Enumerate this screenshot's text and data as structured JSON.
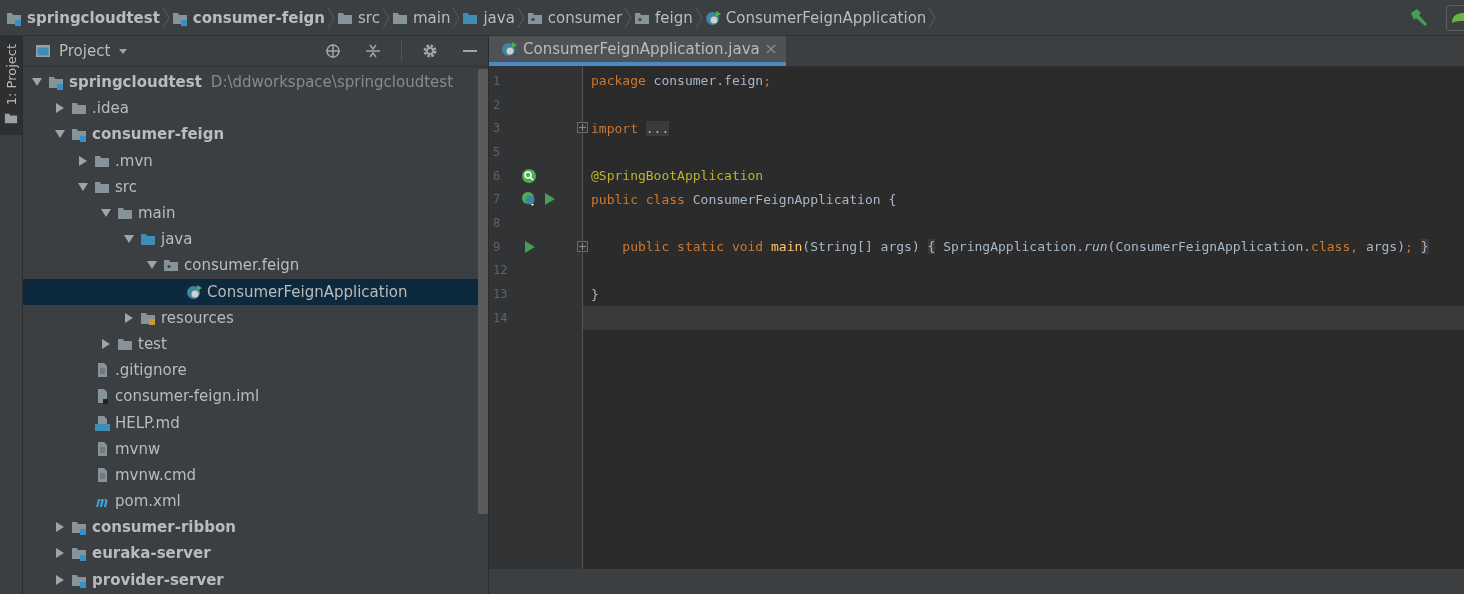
{
  "breadcrumbs": [
    {
      "label": "springcloudtest",
      "kind": "module",
      "bold": true
    },
    {
      "label": "consumer-feign",
      "kind": "module",
      "bold": true
    },
    {
      "label": "src",
      "kind": "folder",
      "bold": false
    },
    {
      "label": "main",
      "kind": "folder",
      "bold": false
    },
    {
      "label": "java",
      "kind": "source",
      "bold": false
    },
    {
      "label": "consumer",
      "kind": "package",
      "bold": false
    },
    {
      "label": "feign",
      "kind": "package",
      "bold": false
    },
    {
      "label": "ConsumerFeignApplication",
      "kind": "spring-class",
      "bold": false
    }
  ],
  "side_stripe": {
    "tab": "1: Project",
    "selected": true
  },
  "project_panel": {
    "title": "Project",
    "tree": [
      {
        "label": "springcloudtest",
        "path": "D:\\ddworkspace\\springcloudtest",
        "kind": "module",
        "bold": true,
        "expanded": true,
        "selected": false,
        "children": [
          {
            "label": ".idea",
            "kind": "folder",
            "bold": false,
            "expanded": false,
            "selected": false
          },
          {
            "label": "consumer-feign",
            "kind": "module",
            "bold": true,
            "expanded": true,
            "selected": false,
            "children": [
              {
                "label": ".mvn",
                "kind": "folder",
                "bold": false,
                "expanded": false,
                "selected": false
              },
              {
                "label": "src",
                "kind": "folder",
                "bold": false,
                "expanded": true,
                "selected": false,
                "children": [
                  {
                    "label": "main",
                    "kind": "folder",
                    "bold": false,
                    "expanded": true,
                    "selected": false,
                    "children": [
                      {
                        "label": "java",
                        "kind": "source",
                        "bold": false,
                        "expanded": true,
                        "selected": false,
                        "children": [
                          {
                            "label": "consumer.feign",
                            "kind": "package",
                            "bold": false,
                            "expanded": true,
                            "selected": false,
                            "children": [
                              {
                                "label": "ConsumerFeignApplication",
                                "kind": "spring-class",
                                "bold": false,
                                "selected": true
                              }
                            ]
                          }
                        ]
                      },
                      {
                        "label": "resources",
                        "kind": "resources",
                        "bold": false,
                        "expanded": false,
                        "selected": false
                      }
                    ]
                  },
                  {
                    "label": "test",
                    "kind": "folder",
                    "bold": false,
                    "expanded": false,
                    "selected": false
                  }
                ]
              },
              {
                "label": ".gitignore",
                "kind": "text-file",
                "bold": false,
                "selected": false
              },
              {
                "label": "consumer-feign.iml",
                "kind": "iml",
                "bold": false,
                "selected": false
              },
              {
                "label": "HELP.md",
                "kind": "markdown",
                "bold": false,
                "selected": false
              },
              {
                "label": "mvnw",
                "kind": "text-file",
                "bold": false,
                "selected": false
              },
              {
                "label": "mvnw.cmd",
                "kind": "text-file",
                "bold": false,
                "selected": false
              },
              {
                "label": "pom.xml",
                "kind": "maven",
                "bold": false,
                "selected": false
              }
            ]
          },
          {
            "label": "consumer-ribbon",
            "kind": "module",
            "bold": true,
            "expanded": false,
            "selected": false
          },
          {
            "label": "euraka-server",
            "kind": "module",
            "bold": true,
            "expanded": false,
            "selected": false
          },
          {
            "label": "provider-server",
            "kind": "module",
            "bold": true,
            "expanded": false,
            "selected": false
          }
        ]
      }
    ]
  },
  "editor_tabs": [
    {
      "label": "ConsumerFeignApplication.java",
      "selected": true
    }
  ],
  "code_lines": [
    {
      "number": "1",
      "tokens": [
        {
          "kind": "keyword",
          "text": "package"
        },
        {
          "kind": "plain",
          "text": " consumer.feign"
        },
        {
          "kind": "keyword",
          "text": ";"
        }
      ]
    },
    {
      "number": "2"
    },
    {
      "number": "3",
      "fold": true,
      "tokens": [
        {
          "kind": "keyword",
          "text": "import "
        },
        {
          "kind": "folded",
          "text": "..."
        }
      ]
    },
    {
      "number": "5"
    },
    {
      "number": "6",
      "markers": [
        {
          "kind": "bean"
        }
      ],
      "tokens": [
        {
          "kind": "annotation",
          "text": "@SpringBootApplication"
        }
      ]
    },
    {
      "number": "7",
      "markers": [
        {
          "kind": "spring-class"
        },
        {
          "kind": "run"
        }
      ],
      "tokens": [
        {
          "kind": "keyword",
          "text": "public class "
        },
        {
          "kind": "plain",
          "text": "ConsumerFeignApplication {"
        }
      ]
    },
    {
      "number": "8"
    },
    {
      "number": "9",
      "markers": [
        {
          "kind": "run"
        }
      ],
      "fold": true,
      "tokens": [
        {
          "kind": "keyword",
          "text": "    public static void "
        },
        {
          "kind": "method",
          "text": "main"
        },
        {
          "kind": "plain",
          "text": "(String[] args) "
        },
        {
          "kind": "folded",
          "text": "{"
        },
        {
          "kind": "plain",
          "text": " SpringApplication."
        },
        {
          "kind": "static",
          "text": "run"
        },
        {
          "kind": "plain",
          "text": "(ConsumerFeignApplication."
        },
        {
          "kind": "keyword",
          "text": "class, "
        },
        {
          "kind": "plain",
          "text": "args)"
        },
        {
          "kind": "keyword",
          "text": "; "
        },
        {
          "kind": "folded",
          "text": "}"
        }
      ]
    },
    {
      "number": "12"
    },
    {
      "number": "13",
      "tokens": [
        {
          "kind": "plain",
          "text": "}"
        }
      ]
    },
    {
      "number": "14",
      "current": true
    }
  ]
}
